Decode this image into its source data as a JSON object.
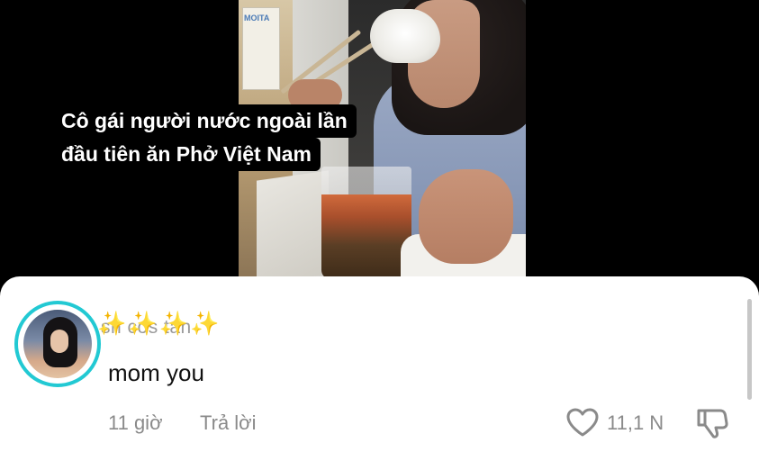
{
  "video": {
    "caption_line1": "Cô gái người nước ngoài lần",
    "caption_line2": "đầu tiên ăn Phở Việt Nam",
    "poster_text": "MOITA"
  },
  "comment": {
    "username": "sn cos tan",
    "sparkles": "✨✨✨✨",
    "text": "mom you",
    "time": "11 giờ",
    "reply_label": "Trả lời",
    "like_count": "11,1 N"
  },
  "colors": {
    "avatar_ring": "#22c9d3",
    "meta_text": "#8a8a8a",
    "sheet_bg": "#ffffff"
  },
  "icons": {
    "like": "heart-outline-icon",
    "dislike": "thumbs-down-outline-icon"
  }
}
